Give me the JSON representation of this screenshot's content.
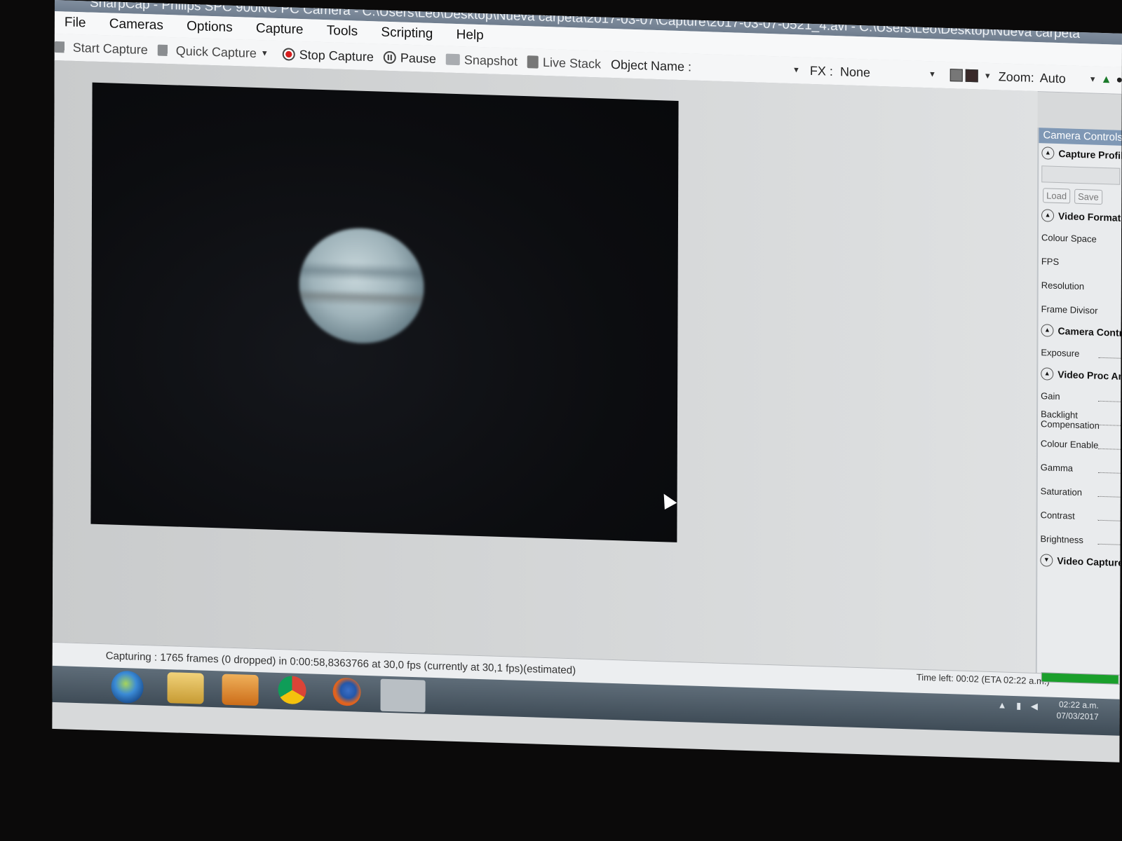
{
  "window": {
    "title": "SharpCap - Philips SPC 900NC PC Camera - C:\\Users\\Leo\\Desktop\\Nueva carpeta\\2017-03-07\\Capture\\2017-03-07-0521_4.avi - C:\\Users\\Leo\\Desktop\\Nueva carpeta"
  },
  "menu": [
    "File",
    "Cameras",
    "Options",
    "Capture",
    "Tools",
    "Scripting",
    "Help"
  ],
  "toolbar": {
    "start_capture": "Start Capture",
    "quick_capture": "Quick Capture",
    "stop_capture": "Stop Capture",
    "pause": "Pause",
    "snapshot": "Snapshot",
    "live_stack": "Live Stack",
    "object_name_label": "Object Name :",
    "fx_label": "FX :",
    "fx_value": "None",
    "zoom_label": "Zoom:",
    "zoom_value": "Auto"
  },
  "panel": {
    "title": "Camera Controls",
    "sections": {
      "capture_profiles": "Capture Profiles",
      "video_format": "Video Format",
      "camera_controls": "Camera Controls",
      "video_proc_amp": "Video Proc Amp",
      "video_capture_filter": "Video Capture Filter"
    },
    "buttons": {
      "load": "Load",
      "save": "Save"
    },
    "video_format_fields": [
      "Colour Space",
      "FPS",
      "Resolution",
      "Frame Divisor"
    ],
    "camera_fields": [
      "Exposure"
    ],
    "proc_amp_fields": [
      "Gain",
      "Backlight Compensation",
      "Colour Enable",
      "Gamma",
      "Saturation",
      "Contrast",
      "Brightness"
    ]
  },
  "status": {
    "capturing": "Capturing : 1765 frames (0 dropped) in 0:00:58,8363766 at 30,0 fps  (currently at 30,1 fps)(estimated)",
    "time_left": "Time left: 00:02 (ETA 02:22 a.m.)",
    "progress": 0.97
  },
  "clock": {
    "time": "02:22 a.m.",
    "date": "07/03/2017"
  },
  "colors": {
    "progress": "#1a9f2b",
    "panel_title": "#7f98b5",
    "stop_red": "#d61d1d"
  }
}
